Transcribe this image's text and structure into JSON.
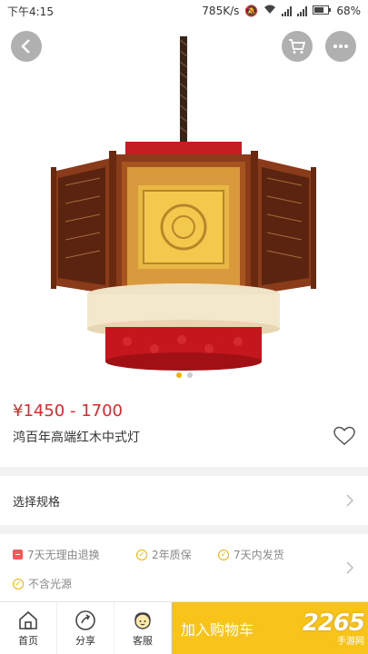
{
  "status": {
    "time": "下午4:15",
    "speed": "785K/s",
    "battery": "68%",
    "net_4g": "4G",
    "net_1x": "1X"
  },
  "product": {
    "price": "¥1450 - 1700",
    "title": "鸿百年高端红木中式灯",
    "gallery_index": 0,
    "gallery_count": 2
  },
  "spec": {
    "label": "选择规格"
  },
  "services": [
    "7天无理由退换",
    "2年质保",
    "7天内发货",
    "不含光源"
  ],
  "tabs": {
    "home": "首页",
    "share": "分享",
    "service": "客服"
  },
  "cta": {
    "add_to_cart": "加入购物车"
  },
  "watermark": {
    "number": "2265",
    "sub": "手游网"
  },
  "colors": {
    "accent": "#f9c41a",
    "price": "#e3242b",
    "dot_active": "#f2b100"
  },
  "icons": [
    "back-icon",
    "cart-icon",
    "more-icon",
    "heart-icon",
    "chevron-right-icon",
    "home-icon",
    "share-icon",
    "service-icon"
  ]
}
